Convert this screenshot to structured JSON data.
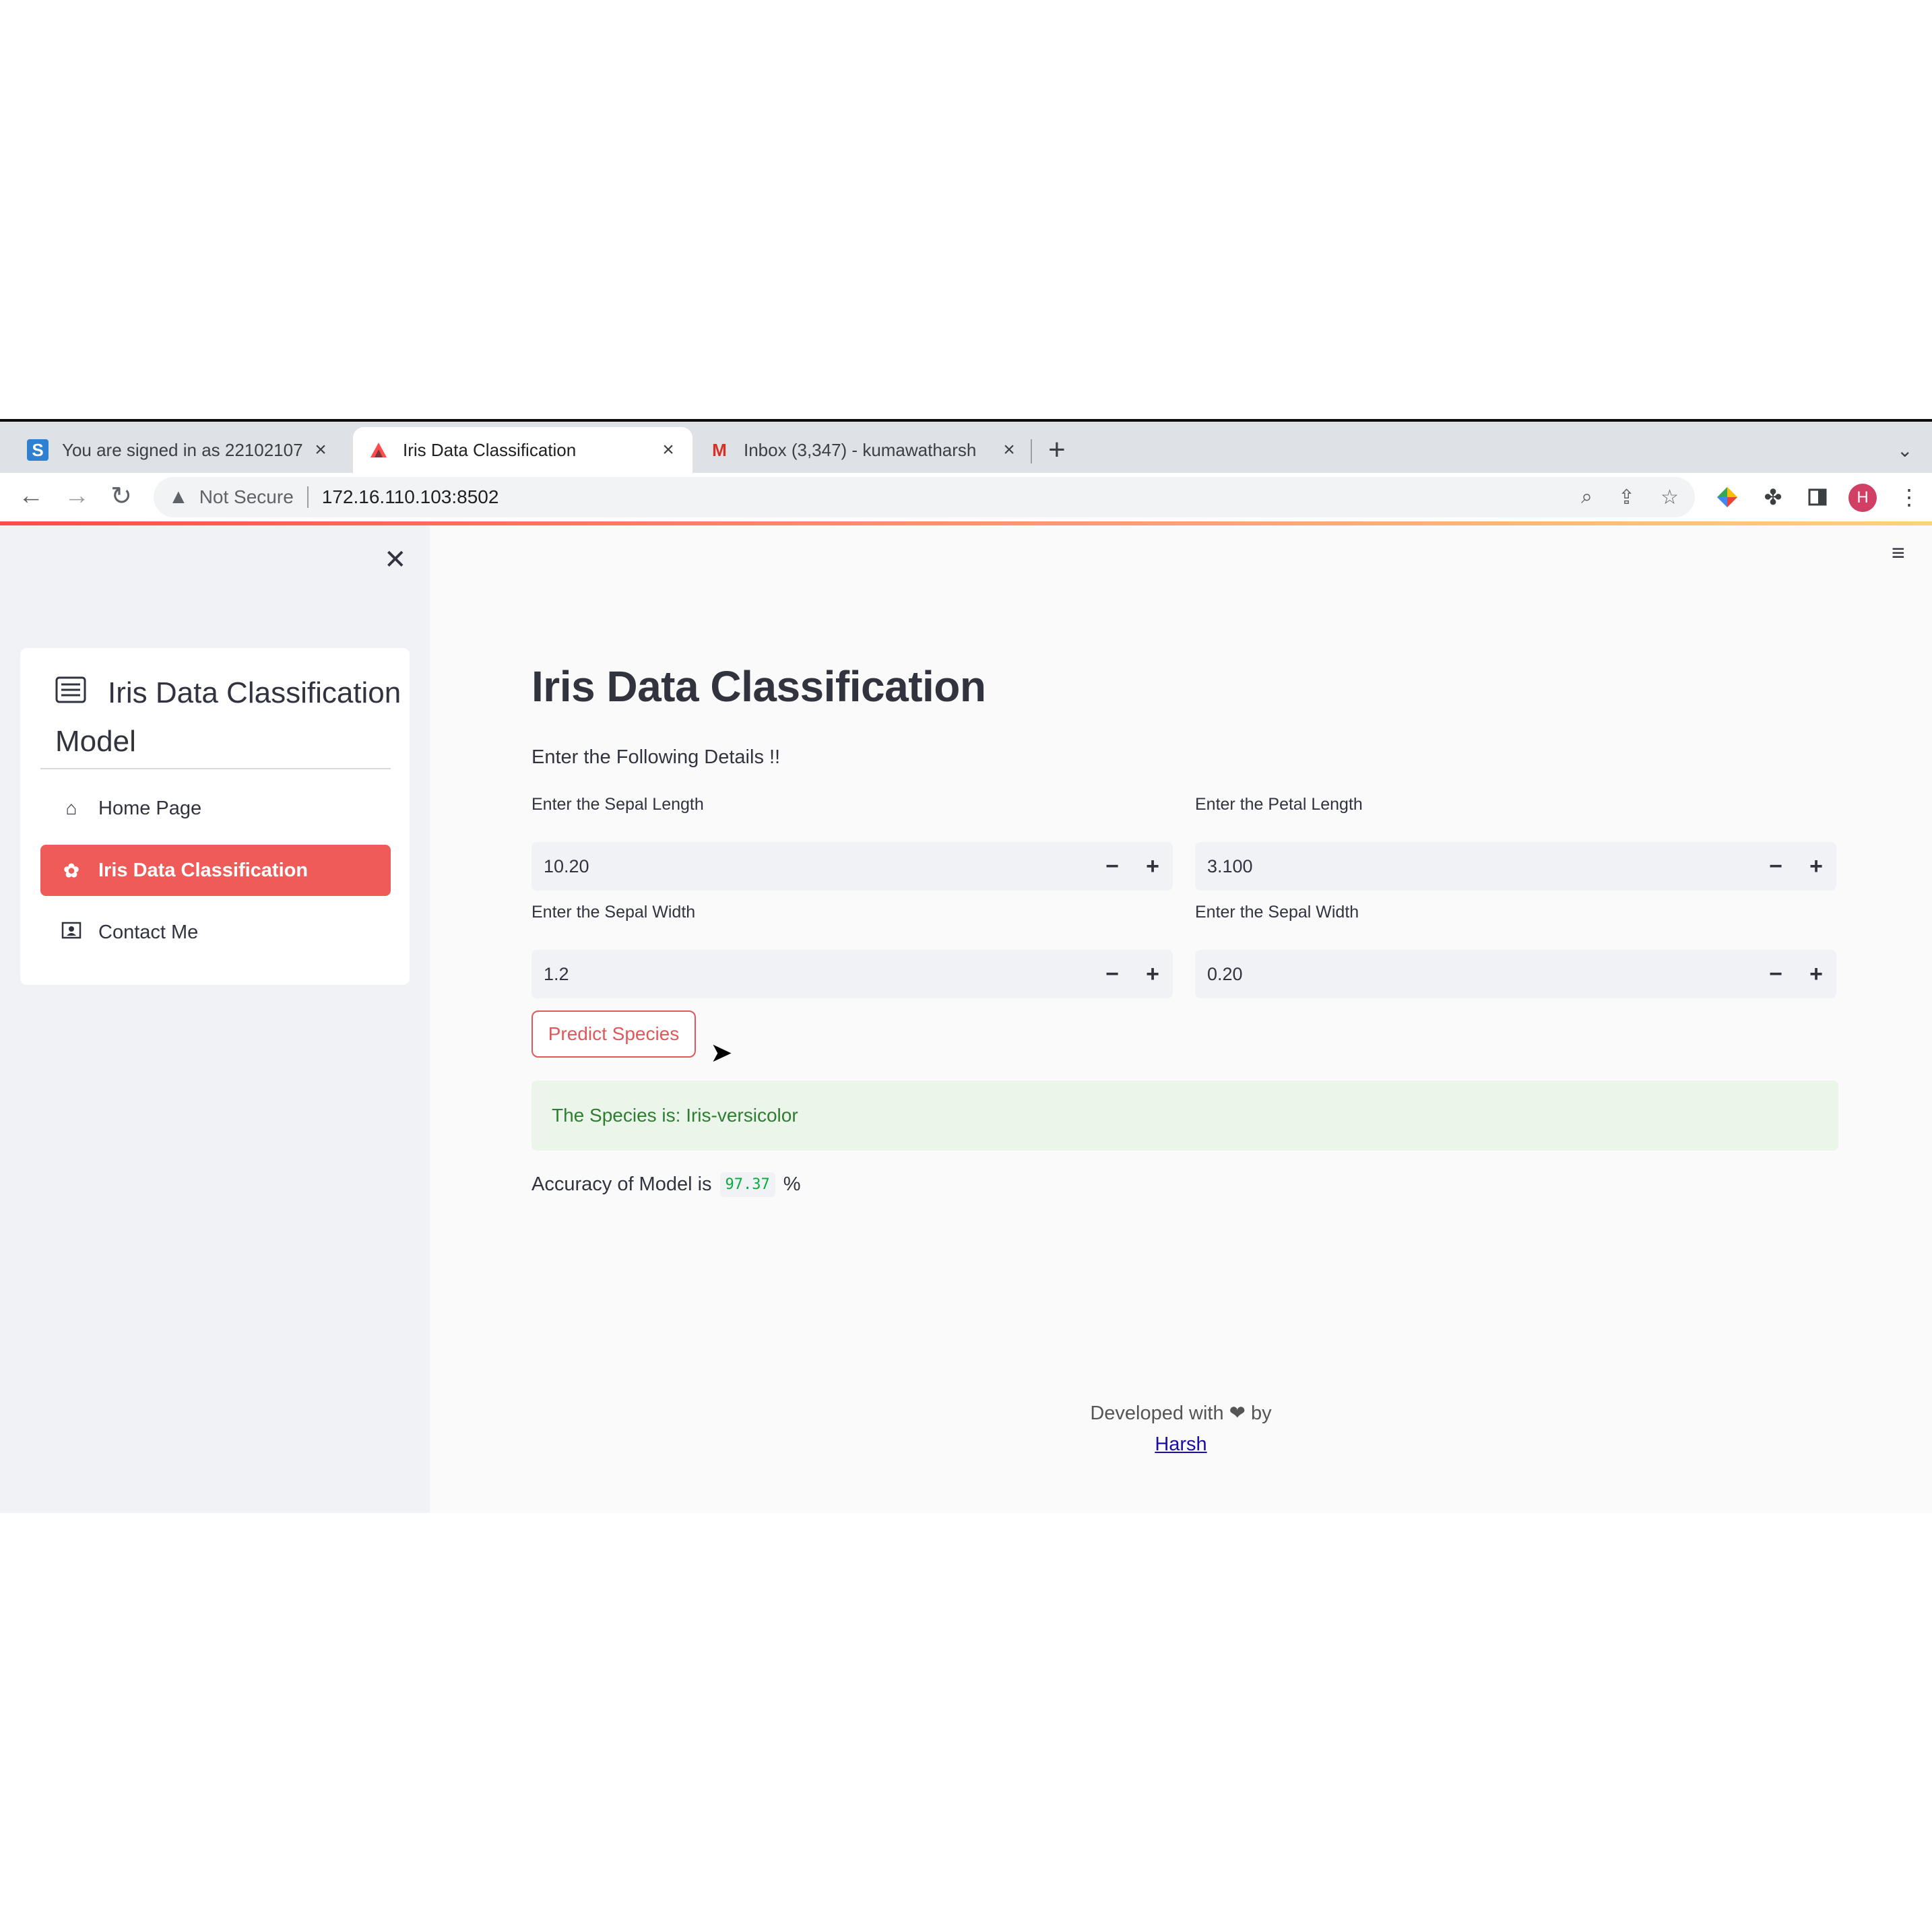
{
  "browser": {
    "tabs": [
      {
        "title": "You are signed in as 22102107",
        "icon": "S",
        "active": false
      },
      {
        "title": "Iris Data Classification",
        "icon": "streamlit-icon",
        "active": true
      },
      {
        "title": "Inbox (3,347) - kumawatharsh",
        "icon": "M",
        "active": false
      }
    ],
    "new_tab_label": "+",
    "security_label": "Not Secure",
    "url": "172.16.110.103:8502",
    "profile_initial": "H"
  },
  "sidebar": {
    "menu_title": "Iris Data Classification Model",
    "items": [
      {
        "label": "Home Page",
        "icon": "home-icon",
        "active": false
      },
      {
        "label": "Iris Data Classification",
        "icon": "flower-icon",
        "active": true
      },
      {
        "label": "Contact Me",
        "icon": "contact-card-icon",
        "active": false
      }
    ]
  },
  "main": {
    "title": "Iris Data Classification",
    "subtitle": "Enter the Following Details !!",
    "fields": [
      {
        "label": "Enter the Sepal Length",
        "value": "10.20"
      },
      {
        "label": "Enter the Petal Length",
        "value": "3.100"
      },
      {
        "label": "Enter the Sepal Width",
        "value": "1.2"
      },
      {
        "label": "Enter the Sepal Width",
        "value": "0.20"
      }
    ],
    "predict_button": "Predict Species",
    "result": "The Species is: Iris-versicolor",
    "accuracy_prefix": "Accuracy of Model is",
    "accuracy_value": "97.37",
    "accuracy_suffix": "%",
    "footer_text": "Developed with ❤ by",
    "footer_link": "Harsh"
  },
  "colors": {
    "accent": "#ef5b58",
    "success_bg": "#ebf5ea",
    "success_text": "#2e7d32",
    "sidebar_bg": "#f0f2f6"
  }
}
